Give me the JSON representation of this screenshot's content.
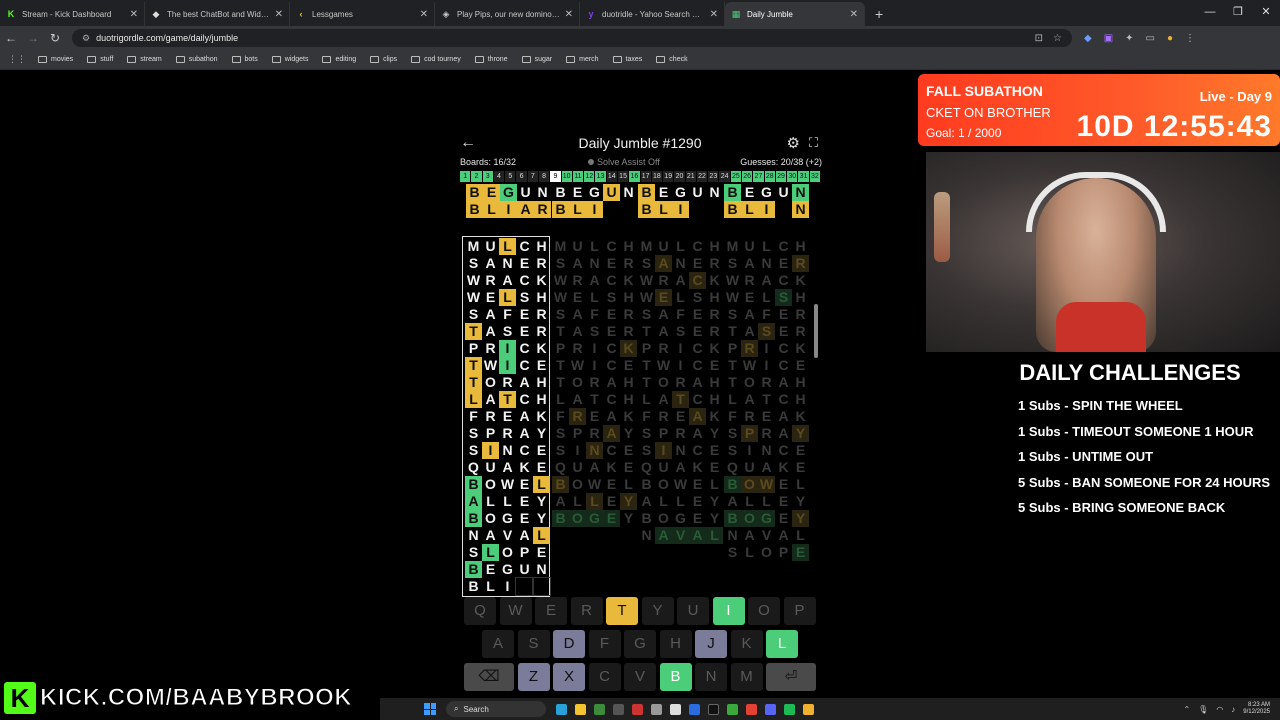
{
  "browser": {
    "tabs": [
      {
        "title": "Stream - Kick Dashboard",
        "color": "#53fc18",
        "glyph": "K"
      },
      {
        "title": "The best ChatBot and Widgets",
        "color": "#dddddd",
        "glyph": "◆"
      },
      {
        "title": "Lessgames",
        "color": "#f0c040",
        "glyph": "‹"
      },
      {
        "title": "Play Pips, our new dominoes ga",
        "color": "#cccccc",
        "glyph": "◈"
      },
      {
        "title": "duotridle - Yahoo Search Resul",
        "color": "#7b3ff2",
        "glyph": "y"
      },
      {
        "title": "Daily Jumble",
        "color": "#4ccd7a",
        "glyph": "▦"
      }
    ],
    "url": "duotrigordle.com/game/daily/jumble",
    "bookmarks": [
      "movies",
      "stuff",
      "stream",
      "subathon",
      "bots",
      "widgets",
      "editing",
      "clips",
      "cod tourney",
      "throne",
      "sugar",
      "merch",
      "taxes",
      "check"
    ]
  },
  "game": {
    "title": "Daily Jumble #1290",
    "boards": "Boards: 16/32",
    "assist": "Solve Assist Off",
    "guesses": "Guesses: 20/38 (+2)",
    "board_numbers": [
      "1",
      "2",
      "3",
      "4",
      "5",
      "6",
      "7",
      "8",
      "9",
      "10",
      "11",
      "12",
      "13",
      "14",
      "15",
      "16",
      "17",
      "18",
      "19",
      "20",
      "21",
      "22",
      "23",
      "24",
      "25",
      "26",
      "27",
      "28",
      "29",
      "30",
      "31",
      "32"
    ],
    "board_solved": [
      1,
      1,
      1,
      0,
      0,
      0,
      0,
      0,
      0,
      1,
      1,
      1,
      1,
      0,
      0,
      1,
      0,
      0,
      0,
      0,
      0,
      0,
      0,
      0,
      1,
      1,
      1,
      1,
      1,
      1,
      1,
      1
    ],
    "current_board": 9,
    "top_rows": [
      {
        "word": "BEGUN",
        "marks": [
          [
            "y",
            "y",
            "g",
            "",
            ""
          ],
          [
            "",
            "",
            "",
            "y",
            ""
          ],
          [
            "y",
            "",
            "",
            "",
            ""
          ],
          [
            "g",
            "",
            "",
            "",
            "g"
          ]
        ]
      },
      {
        "word": "BLI",
        "marks": [
          [
            "y",
            "y",
            "y",
            "y",
            "y"
          ],
          [
            "y",
            "y",
            "y",
            "",
            ""
          ],
          [
            "y",
            "y",
            "y",
            "",
            ""
          ],
          [
            "y",
            "y",
            "y",
            "",
            "y"
          ]
        ]
      }
    ],
    "top_row2_tail": [
      "AR",
      "",
      "",
      "N"
    ],
    "main_board": [
      {
        "w": "MULCH",
        "m": [
          "",
          "",
          "y",
          "",
          ""
        ]
      },
      {
        "w": "SANER",
        "m": [
          "",
          "",
          "",
          "",
          ""
        ]
      },
      {
        "w": "WRACK",
        "m": [
          "",
          "",
          "",
          "",
          ""
        ]
      },
      {
        "w": "WELSH",
        "m": [
          "",
          "",
          "y",
          "",
          ""
        ]
      },
      {
        "w": "SAFER",
        "m": [
          "",
          "",
          "",
          "",
          ""
        ]
      },
      {
        "w": "TASER",
        "m": [
          "y",
          "",
          "",
          "",
          ""
        ]
      },
      {
        "w": "PRICK",
        "m": [
          "",
          "",
          "g",
          "",
          ""
        ]
      },
      {
        "w": "TWICE",
        "m": [
          "y",
          "",
          "g",
          "",
          ""
        ]
      },
      {
        "w": "TORAH",
        "m": [
          "y",
          "",
          "",
          "",
          ""
        ]
      },
      {
        "w": "LATCH",
        "m": [
          "y",
          "",
          "y",
          "",
          ""
        ]
      },
      {
        "w": "FREAK",
        "m": [
          "",
          "",
          "",
          "",
          ""
        ]
      },
      {
        "w": "SPRAY",
        "m": [
          "",
          "",
          "",
          "",
          ""
        ]
      },
      {
        "w": "SINCE",
        "m": [
          "",
          "y",
          "",
          "",
          ""
        ]
      },
      {
        "w": "QUAKE",
        "m": [
          "",
          "",
          "",
          "",
          ""
        ]
      },
      {
        "w": "BOWEL",
        "m": [
          "g",
          "",
          "",
          "",
          "y"
        ]
      },
      {
        "w": "ALLEY",
        "m": [
          "g",
          "",
          "",
          "",
          ""
        ]
      },
      {
        "w": "BOGEY",
        "m": [
          "g",
          "",
          "",
          "",
          ""
        ]
      },
      {
        "w": "NAVAL",
        "m": [
          "",
          "",
          "",
          "",
          "y"
        ]
      },
      {
        "w": "SLOPE",
        "m": [
          "",
          "g",
          "",
          "",
          ""
        ]
      },
      {
        "w": "BEGUN",
        "m": [
          "g",
          "",
          "",
          "",
          ""
        ]
      },
      {
        "w": "BLI",
        "m": [
          "",
          "",
          "",
          "",
          ""
        ]
      }
    ],
    "faded_columns": [
      {
        "rows": 17,
        "marks": {
          "6": [
            null,
            null,
            null,
            null,
            "fy"
          ],
          "10": [
            null,
            "fy",
            null,
            null,
            null
          ],
          "11": [
            null,
            null,
            null,
            "fy",
            null
          ],
          "12": [
            null,
            null,
            "fy",
            null,
            null
          ],
          "14": [
            "fy",
            null,
            null,
            null,
            null
          ],
          "15": [
            null,
            null,
            "fy",
            null,
            "fy"
          ],
          "16": [
            "fg",
            "fg",
            "fg",
            "fg",
            null
          ]
        }
      },
      {
        "rows": 18,
        "marks": {
          "1": [
            null,
            "fy",
            null,
            null,
            null
          ],
          "2": [
            null,
            null,
            null,
            "fy",
            null
          ],
          "3": [
            null,
            "fy",
            null,
            null,
            null
          ],
          "9": [
            null,
            null,
            "fy",
            null,
            null
          ],
          "10": [
            null,
            null,
            null,
            "fy",
            null
          ],
          "12": [
            null,
            "fy",
            null,
            null,
            null
          ],
          "17": [
            null,
            "fg",
            "fg",
            "fg",
            "fg"
          ]
        }
      },
      {
        "rows": 19,
        "marks": {
          "1": [
            null,
            null,
            null,
            null,
            "fy"
          ],
          "3": [
            null,
            null,
            null,
            "fg",
            null
          ],
          "5": [
            null,
            null,
            "fy",
            null,
            null
          ],
          "6": [
            null,
            "fy",
            null,
            null,
            null
          ],
          "11": [
            null,
            "fy",
            null,
            null,
            "fy"
          ],
          "14": [
            "fg",
            "fy",
            "fy",
            null,
            null
          ],
          "16": [
            "fg",
            "fg",
            "fg",
            null,
            "fy"
          ],
          "18": [
            null,
            null,
            null,
            null,
            "fg"
          ]
        }
      }
    ]
  },
  "keyboard": {
    "rows": [
      [
        {
          "k": "Q",
          "s": ""
        },
        {
          "k": "W",
          "s": ""
        },
        {
          "k": "E",
          "s": ""
        },
        {
          "k": "R",
          "s": ""
        },
        {
          "k": "T",
          "s": "y"
        },
        {
          "k": "Y",
          "s": ""
        },
        {
          "k": "U",
          "s": ""
        },
        {
          "k": "I",
          "s": "g"
        },
        {
          "k": "O",
          "s": ""
        },
        {
          "k": "P",
          "s": ""
        }
      ],
      [
        {
          "k": "A",
          "s": ""
        },
        {
          "k": "S",
          "s": ""
        },
        {
          "k": "D",
          "s": "p"
        },
        {
          "k": "F",
          "s": ""
        },
        {
          "k": "G",
          "s": ""
        },
        {
          "k": "H",
          "s": ""
        },
        {
          "k": "J",
          "s": "p"
        },
        {
          "k": "K",
          "s": ""
        },
        {
          "k": "L",
          "s": "g"
        }
      ],
      [
        {
          "k": "⌫",
          "s": "w"
        },
        {
          "k": "Z",
          "s": "p"
        },
        {
          "k": "X",
          "s": "p"
        },
        {
          "k": "C",
          "s": ""
        },
        {
          "k": "V",
          "s": ""
        },
        {
          "k": "B",
          "s": "g"
        },
        {
          "k": "N",
          "s": ""
        },
        {
          "k": "M",
          "s": ""
        },
        {
          "k": "⏎",
          "s": "w"
        }
      ]
    ]
  },
  "overlay": {
    "subathon_title": "FALL SUBATHON",
    "ticker": "CKET ON BROTHER",
    "goal": "Goal: 1 / 2000",
    "live": "Live - Day 9",
    "timer": "10D 12:55:43",
    "challenges_title": "DAILY CHALLENGES",
    "challenges": [
      "1 Subs - SPIN THE WHEEL",
      "1 Subs - TIMEOUT SOMEONE 1 HOUR",
      "1 Subs - UNTIME OUT",
      "5 Subs - BAN SOMEONE FOR 24 HOURS",
      "5 Subs - BRING SOMEONE BACK"
    ],
    "kick_logo": "K",
    "kick_text": "KICK.COM/BAABYBROOK"
  },
  "taskbar": {
    "search": "Search",
    "time": "8:23 AM",
    "date": "9/12/2025"
  }
}
